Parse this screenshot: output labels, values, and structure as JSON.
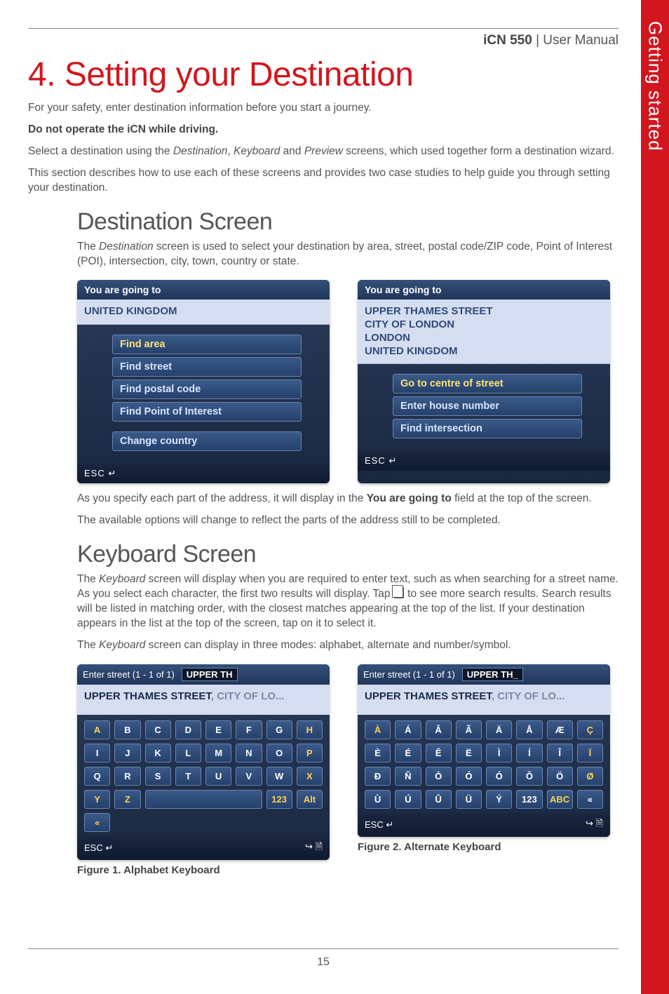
{
  "header": {
    "product": "iCN 550",
    "suffix": " | User Manual"
  },
  "sidebar_tab": "Getting started",
  "title": "4. Setting your Destination",
  "intro1": "For your safety, enter destination information before you start a journey.",
  "intro_bold": "Do not operate the iCN while driving.",
  "intro2a": "Select a destination using the ",
  "intro2_dest": "Destination",
  "intro2b": ", ",
  "intro2_kbd": "Keyboard",
  "intro2c": " and ",
  "intro2_prev": "Preview",
  "intro2d": " screens, which used together form a destination wizard.",
  "intro3": "This section describes how to use each of these screens and provides two case studies to help guide you through setting your destination.",
  "dest": {
    "heading": "Destination Screen",
    "p1a": "The ",
    "p1_em": "Destination",
    "p1b": " screen is used to select your destination by area, street, postal code/ZIP code, Point of Interest (POI), intersection, city, town, country or state.",
    "shot1": {
      "bar": "You are going to",
      "addr": "UNITED KINGDOM",
      "items": [
        "Find area",
        "Find street",
        "Find postal code",
        "Find Point of Interest",
        "Change country"
      ],
      "selected_index": 0,
      "esc": "ESC ↵"
    },
    "shot2": {
      "bar": "You are going to",
      "addr_lines": [
        "UPPER THAMES STREET",
        "CITY OF LONDON",
        "LONDON",
        "UNITED KINGDOM"
      ],
      "items": [
        "Go to centre of street",
        "Enter house number",
        "Find intersection"
      ],
      "selected_index": 0,
      "esc": "ESC ↵"
    },
    "p2a": "As you specify each part of the address, it will display in the ",
    "p2_bold": "You are going to",
    "p2b": " field at the top of the screen.",
    "p3": "The available options will change to reflect the parts of the address still to be completed."
  },
  "kbd": {
    "heading": "Keyboard Screen",
    "p1a": "The ",
    "p1_em": "Keyboard",
    "p1b": " screen will display when you are required to enter text, such as when searching for a street name. As you select each character, the first two results will display. Tap ",
    "p1c": " to see more search results. Search results will be listed in matching order, with the closest matches appearing at the top of the list. If your destination appears in the list at the top of the screen, tap on it to select it.",
    "p2a": "The ",
    "p2_em": "Keyboard",
    "p2b": " screen can display in three modes: alphabet, alternate and number/symbol.",
    "shot1": {
      "label": "Enter street (1 - 1 of 1)",
      "entry": "UPPER TH",
      "result_strong": "UPPER THAMES STREET",
      "result_tail": ", CITY OF LO...",
      "rows": [
        [
          "A",
          "B",
          "C",
          "D",
          "E",
          "F",
          "G",
          "H"
        ],
        [
          "I",
          "J",
          "K",
          "L",
          "M",
          "N",
          "O",
          "P"
        ],
        [
          "Q",
          "R",
          "S",
          "T",
          "U",
          "V",
          "W",
          "X"
        ]
      ],
      "row4": {
        "letters": [
          "Y",
          "Z"
        ],
        "space": "",
        "k123": "123",
        "alt": "Alt",
        "back": "«"
      },
      "warm_set": [
        "A",
        "H",
        "P",
        "X"
      ],
      "esc": "ESC ↵",
      "next": "↪ 🗎",
      "caption": "Figure 1. Alphabet Keyboard"
    },
    "shot2": {
      "label": "Enter street (1 - 1 of 1)",
      "entry": "UPPER TH_",
      "result_strong": "UPPER THAMES STREET",
      "result_tail": ", CITY OF LO...",
      "rows": [
        [
          "À",
          "Á",
          "Â",
          "Ã",
          "Ä",
          "Å",
          "Æ",
          "Ç"
        ],
        [
          "È",
          "É",
          "Ê",
          "Ë",
          "Ì",
          "Í",
          "Î",
          "Ï"
        ],
        [
          "Ð",
          "Ñ",
          "Ò",
          "Ó",
          "Ó",
          "Ô",
          "Ö",
          "Ø"
        ],
        [
          "Ù",
          "Ú",
          "Û",
          "Ü",
          "Ý",
          "123",
          "ABC",
          "«"
        ]
      ],
      "warm_set": [
        "À",
        "Ç",
        "Ï",
        "Ø",
        "ABC"
      ],
      "esc": "ESC ↵",
      "next": "↪ 🗎",
      "caption": "Figure 2. Alternate Keyboard"
    }
  },
  "page_number": "15"
}
